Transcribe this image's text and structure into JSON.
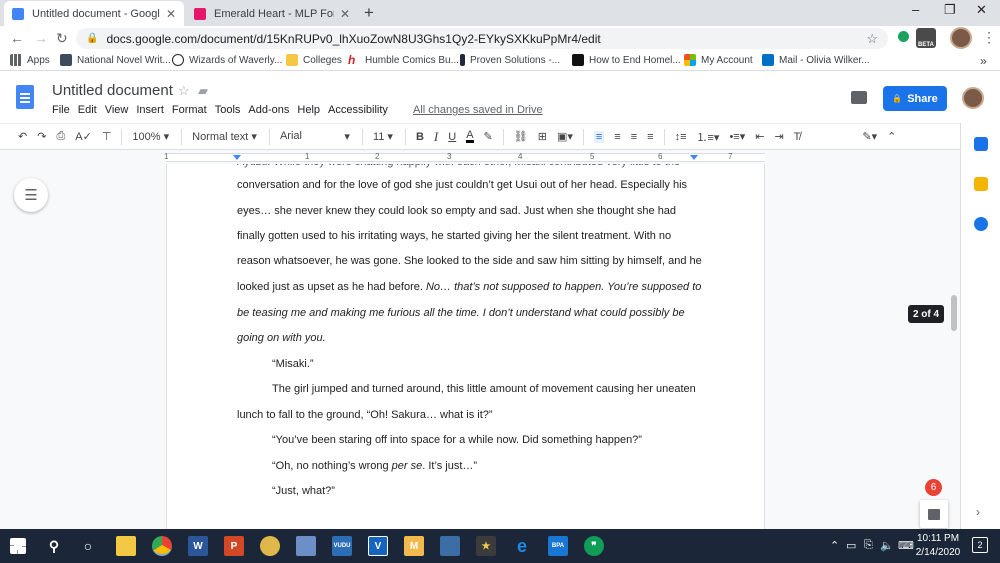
{
  "browser": {
    "tabs": [
      {
        "title": "Untitled document - Google Doc",
        "active": true,
        "favicon_color": "#4285f4"
      },
      {
        "title": "Emerald Heart - MLP Forums",
        "active": false,
        "favicon_color": "#e5176b"
      }
    ],
    "new_tab": "+",
    "url": "docs.google.com/document/d/15KnRUPv0_lhXuoZowN8U3Ghs1Qy2-EYkySXKkuPpMr4/edit",
    "extension_beta": "BETA",
    "bookmarks": [
      {
        "label": "Apps",
        "color": "#5f6368"
      },
      {
        "label": "National Novel Writ...",
        "color": "#3d4c5c"
      },
      {
        "label": "Wizards of Waverly...",
        "color": "#222222"
      },
      {
        "label": "Colleges",
        "color": "#f6c744"
      },
      {
        "label": "Humble Comics Bu...",
        "color": "#cc2b2b"
      },
      {
        "label": "Proven Solutions -...",
        "color": "#1d2a3a"
      },
      {
        "label": "How to End Homel...",
        "color": "#111111"
      },
      {
        "label": "My Account",
        "color": "#f25022"
      },
      {
        "label": "Mail - Olivia Wilker...",
        "color": "#0072c6"
      }
    ],
    "bookmarks_more": "»"
  },
  "docs": {
    "title": "Untitled document",
    "menu": [
      "File",
      "Edit",
      "View",
      "Insert",
      "Format",
      "Tools",
      "Add-ons",
      "Help",
      "Accessibility"
    ],
    "saved_status": "All changes saved in Drive",
    "share_label": "Share",
    "toolbar": {
      "zoom": "100%",
      "style": "Normal text",
      "font": "Arial",
      "size": "11",
      "bold": "B",
      "italic": "I",
      "underline": "U",
      "text_color": "A"
    },
    "ruler_numbers": [
      "1",
      "1",
      "2",
      "3",
      "4",
      "5",
      "6",
      "7"
    ],
    "page_indicator": "2 of 4",
    "notification_count": "6"
  },
  "document": {
    "lines": [
      {
        "text": "conversation and for the love of god she just couldn’t get Usui out of her head. Especially his",
        "indent": false
      },
      {
        "text": "eyes… she never knew they could look so empty and sad. Just when she thought she had",
        "indent": false
      },
      {
        "text": "finally gotten used to his irritating ways, he started giving her the silent treatment. With no",
        "indent": false
      },
      {
        "text": "reason whatsoever, he was gone. She looked to the side and saw him sitting by himself, and he",
        "indent": false
      },
      {
        "text": "looked just as upset as he had before. ",
        "italic_tail": "No… that’s not supposed to happen. You’re supposed to",
        "indent": false
      },
      {
        "text": "",
        "italic_tail": "be teasing me and making me furious all the time. I don’t understand what could possibly be",
        "indent": false
      },
      {
        "text": "",
        "italic_tail": "going on with you.",
        "indent": false
      },
      {
        "text": "“Misaki.”",
        "indent": true
      },
      {
        "text": "The girl jumped and turned around, this little amount of movement causing her uneaten",
        "indent": true
      },
      {
        "text": "lunch to fall to the ground, “Oh! Sakura… what is it?”",
        "indent": false
      },
      {
        "text": "“You’ve been staring off into space for a while now. Did something happen?”",
        "indent": true
      },
      {
        "text": "“Oh, no nothing’s wrong ",
        "italic_mid": "per se",
        "text_after": ". It’s just…”",
        "indent": true
      },
      {
        "text": "“Just, what?”",
        "indent": true
      }
    ]
  },
  "taskbar": {
    "clock_time": "10:11 PM",
    "clock_date": "2/14/2020",
    "notification_badge": "2",
    "apps": [
      {
        "name": "file-explorer",
        "color": "#f3c843",
        "label": ""
      },
      {
        "name": "chrome",
        "color": "#4caf50",
        "label": ""
      },
      {
        "name": "word",
        "color": "#2b579a",
        "label": "W"
      },
      {
        "name": "powerpoint",
        "color": "#d24726",
        "label": "P"
      },
      {
        "name": "app-yellow",
        "color": "#e0b84a",
        "label": ""
      },
      {
        "name": "app-paint",
        "color": "#6d8fc7",
        "label": ""
      },
      {
        "name": "app-vudu",
        "color": "#2d6db5",
        "label": "VUDU"
      },
      {
        "name": "app-v",
        "color": "#1565c0",
        "label": "V"
      },
      {
        "name": "app-m",
        "color": "#f2b94c",
        "label": "M"
      },
      {
        "name": "app-photos",
        "color": "#3a6ea5",
        "label": ""
      },
      {
        "name": "app-star",
        "color": "#3b3b3b",
        "label": "★"
      },
      {
        "name": "edge",
        "color": "#1e88e5",
        "label": "e"
      },
      {
        "name": "app-blue",
        "color": "#1976d2",
        "label": "BPA"
      },
      {
        "name": "hangouts",
        "color": "#0f9d58",
        "label": "❞"
      }
    ]
  }
}
